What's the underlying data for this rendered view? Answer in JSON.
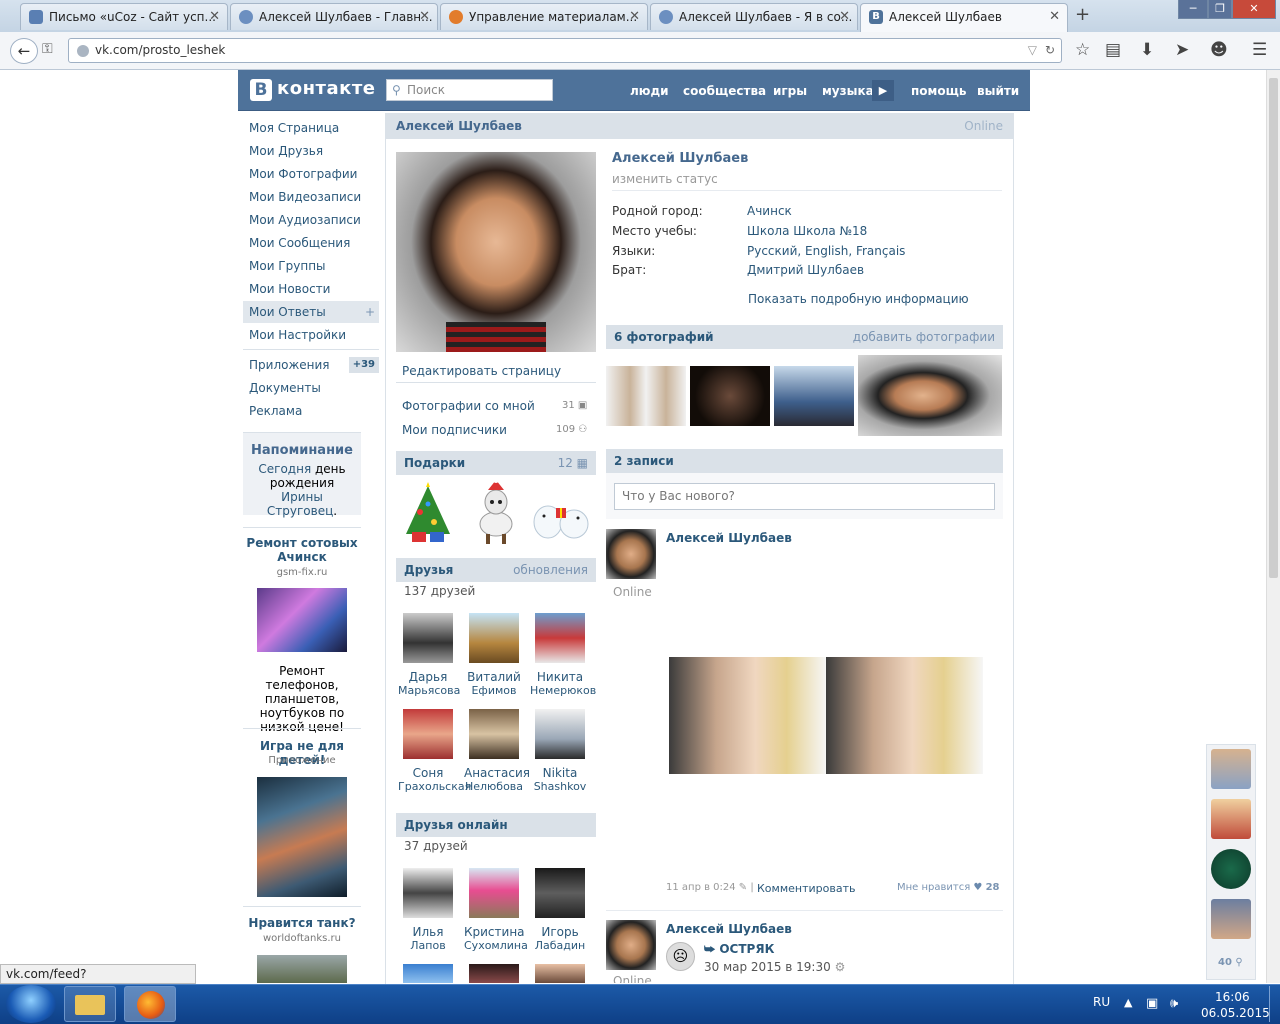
{
  "browser": {
    "tabs": [
      {
        "title": "Письмо «uCoz - Сайт усп...",
        "active": false
      },
      {
        "title": "Алексей Шулбаев - Главн...",
        "active": false
      },
      {
        "title": "Управление материалам...",
        "active": false
      },
      {
        "title": "Алексей Шулбаев - Я в со...",
        "active": false
      },
      {
        "title": "Алексей Шулбаев",
        "active": true
      }
    ],
    "url": "vk.com/prosto_leshek",
    "status_url": "vk.com/feed?section=notifications"
  },
  "header": {
    "logo_letter": "В",
    "logo_text": "контакте",
    "search_placeholder": "Поиск",
    "nav": [
      "люди",
      "сообщества",
      "игры",
      "музыка",
      "помощь",
      "выйти"
    ],
    "accent": "#4e729a"
  },
  "left_menu": {
    "items": [
      "Моя Страница",
      "Мои Друзья",
      "Мои Фотографии",
      "Мои Видеозаписи",
      "Мои Аудиозаписи",
      "Мои Сообщения",
      "Мои Группы",
      "Мои Новости",
      "Мои Ответы",
      "Мои Настройки"
    ],
    "answers_plus": "+",
    "extra": [
      "Приложения",
      "Документы",
      "Реклама"
    ],
    "apps_badge": "+39"
  },
  "reminder": {
    "title": "Напоминание",
    "today": "Сегодня",
    "text1": " день рождения ",
    "name": "Ирины Струговец",
    "dot": "."
  },
  "ads": [
    {
      "title": "Ремонт сотовых Ачинск",
      "sub": "gsm-fix.ru",
      "text": "Ремонт телефонов, планшетов, ноутбуков по низкой цене!"
    },
    {
      "title": "Игра не для детей!",
      "sub": "Приложение"
    },
    {
      "title": "Нравится танк?",
      "sub": "worldoftanks.ru"
    }
  ],
  "profile": {
    "header_name": "Алексей Шулбаев",
    "online": "Online",
    "name": "Алексей Шулбаев",
    "status_link": "изменить статус",
    "fields": [
      {
        "label": "Родной город:",
        "value": "Ачинск"
      },
      {
        "label": "Место учебы:",
        "value": "Школа Школа №18"
      },
      {
        "label": "Языки:",
        "value": "Русский, English, Français"
      },
      {
        "label": "Брат:",
        "value": "Дмитрий Шулбаев"
      }
    ],
    "more_info": "Показать подробную информацию",
    "edit_page": "Редактировать страницу",
    "photos_with_me": "Фотографии со мной",
    "photos_with_me_count": "31",
    "followers": "Мои подписчики",
    "followers_count": "109"
  },
  "gifts": {
    "title": "Подарки",
    "count": "12"
  },
  "friends": {
    "title": "Друзья",
    "updates": "обновления",
    "count_text": "137 друзей",
    "list": [
      {
        "first": "Дарья",
        "last": "Марьясова"
      },
      {
        "first": "Виталий",
        "last": "Ефимов"
      },
      {
        "first": "Никита",
        "last": "Немерюков"
      },
      {
        "first": "Соня",
        "last": "Грахольская"
      },
      {
        "first": "Анастасия",
        "last": "Нелюбова"
      },
      {
        "first": "Nikita",
        "last": "Shashkov"
      }
    ]
  },
  "friends_online": {
    "title": "Друзья онлайн",
    "count_text": "37 друзей",
    "list": [
      {
        "first": "Илья",
        "last": "Лапов"
      },
      {
        "first": "Кристина",
        "last": "Сухомлина"
      },
      {
        "first": "Игорь",
        "last": "Лабадин"
      }
    ]
  },
  "photos": {
    "title": "6 фотографий",
    "add": "добавить фотографии"
  },
  "wall": {
    "title": "2 записи",
    "placeholder": "Что у Вас нового?",
    "post1": {
      "author": "Алексей Шулбаев",
      "online": "Online",
      "date": "11 апр в 0:24",
      "separator": "|",
      "comment": "Комментировать",
      "like_label": "Мне нравится",
      "likes": "28"
    },
    "post2": {
      "author": "Алексей Шулбаев",
      "repost_name": "ОСТРЯК",
      "date": "30 мар 2015 в 19:30",
      "online": "Online"
    }
  },
  "side_friends": {
    "count": "40"
  },
  "taskbar": {
    "lang": "RU",
    "time": "16:06",
    "date": "06.05.2015"
  }
}
